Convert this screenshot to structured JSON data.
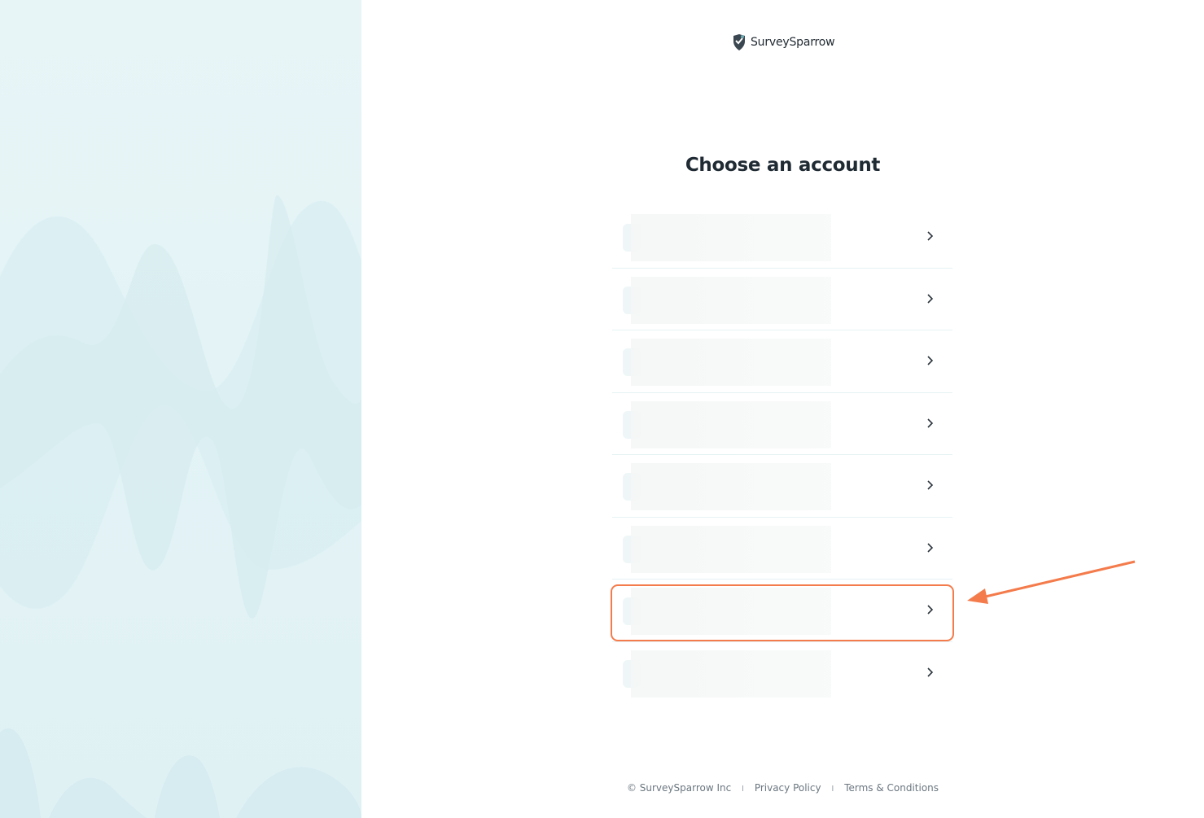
{
  "brand": {
    "name": "SurveySparrow",
    "logo_icon": "sparrow-shield-icon"
  },
  "title": "Choose an account",
  "accounts": [
    {
      "name": "",
      "email": ""
    },
    {
      "name": "",
      "email": ""
    },
    {
      "name": "",
      "email": ""
    },
    {
      "name": "",
      "email": ""
    },
    {
      "name": "",
      "email": ""
    },
    {
      "name": "",
      "email": ""
    },
    {
      "name": "",
      "email": ""
    },
    {
      "name": "",
      "email": ""
    }
  ],
  "highlighted_account_index": 6,
  "footer": {
    "copyright": "© SurveySparrow Inc",
    "separator": "I",
    "privacy": "Privacy Policy",
    "terms": "Terms & Conditions"
  },
  "colors": {
    "highlight": "#f47b4b",
    "left_panel_bg": "#e3f3f6",
    "title": "#1f2a33"
  }
}
